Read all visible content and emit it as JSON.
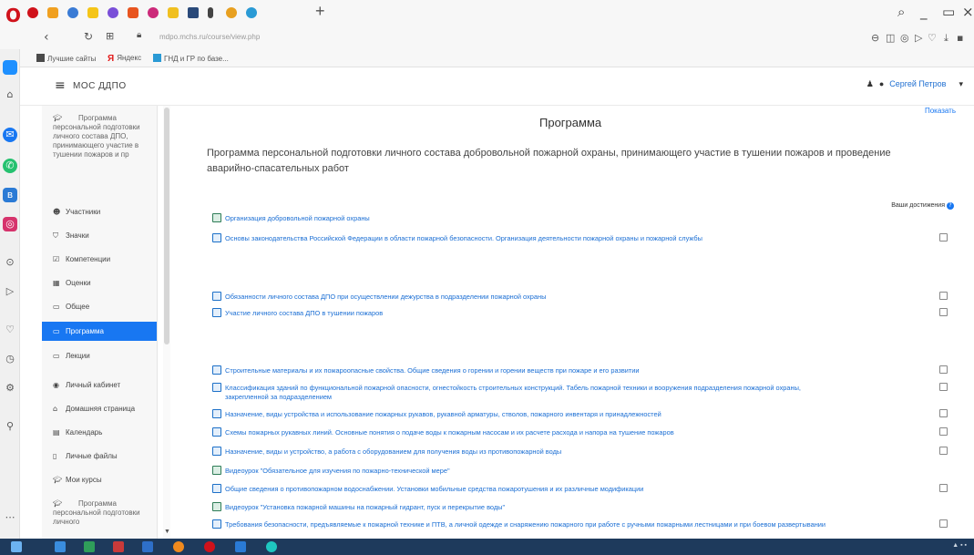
{
  "browser": {
    "url": "mdpo.mchs.ru/course/view.php",
    "bookmarks": [
      {
        "label": "Лучшие сайты",
        "icon": "bookmark-icon"
      },
      {
        "label": "Яндекс",
        "icon": "yandex-icon"
      },
      {
        "label": "ГНД и ГР по базе...",
        "icon": "folder-icon"
      }
    ],
    "colors": {
      "accent": "#1877f2",
      "taskbar": "#1e3a5c",
      "opera": "#d0121b"
    }
  },
  "header": {
    "brand": "МОС ДДПО",
    "user_name": "Сергей Петров"
  },
  "nav": {
    "items": [
      {
        "label": "Программа персональной подготовки личного состава ДПО, принимающего участие в тушении пожаров и пр",
        "icon": "graduation-cap-icon"
      },
      {
        "label": "Участники",
        "icon": "users-icon"
      },
      {
        "label": "Значки",
        "icon": "shield-icon"
      },
      {
        "label": "Компетенции",
        "icon": "check-circle-icon"
      },
      {
        "label": "Оценки",
        "icon": "table-icon"
      },
      {
        "label": "Общее",
        "icon": "folder-icon"
      },
      {
        "label": "Программа",
        "icon": "folder-icon"
      },
      {
        "label": "Лекции",
        "icon": "folder-icon"
      },
      {
        "label": "Личный кабинет",
        "icon": "dashboard-icon"
      },
      {
        "label": "Домашняя страница",
        "icon": "home-icon"
      },
      {
        "label": "Календарь",
        "icon": "calendar-icon"
      },
      {
        "label": "Личные файлы",
        "icon": "file-icon"
      },
      {
        "label": "Мои курсы",
        "icon": "graduation-cap-icon"
      },
      {
        "label": "Программа персональной подготовки личного",
        "icon": "graduation-cap-icon"
      }
    ]
  },
  "main": {
    "expand_link": "Показать",
    "title": "Программа",
    "description": "Программа персональной подготовки личного состава добровольной пожарной охраны, принимающего участие в тушении пожаров и проведение аварийно-спасательных работ",
    "progress_label": "Ваши достижения",
    "activities": [
      {
        "text": "Организация добровольной пожарной охраны",
        "icon": "file",
        "checkbox": false
      },
      {
        "text": "Основы законодательства Российской Федерации в области пожарной безопасности. Организация деятельности пожарной охраны и пожарной службы",
        "icon": "page",
        "checkbox": true
      },
      {
        "text": "Обязанности личного состава ДПО при осуществлении дежурства в подразделении пожарной охраны",
        "icon": "page",
        "checkbox": true
      },
      {
        "text": "Участие личного состава ДПО в тушении пожаров",
        "icon": "page",
        "checkbox": true
      },
      {
        "text": "Строительные материалы и их пожароопасные свойства. Общие сведения о горении и горении веществ при пожаре и его развитии",
        "icon": "page",
        "checkbox": true
      },
      {
        "text": "Классификация зданий по функциональной пожарной опасности, огнестойкость строительных конструкций. Табель пожарной техники и вооружения подразделения пожарной охраны,",
        "text2": "закрепленной за подразделением",
        "icon": "page",
        "checkbox": true
      },
      {
        "text": "Назначение, виды устройства и использование пожарных рукавов, рукавной арматуры, стволов, пожарного инвентаря и принадлежностей",
        "icon": "page",
        "checkbox": true
      },
      {
        "text": "Схемы пожарных рукавных линий. Основные понятия о подаче воды к пожарным насосам и их расчете расхода и напора на тушение пожаров",
        "icon": "page",
        "checkbox": true
      },
      {
        "text": "Назначение, виды и устройство, а работа с оборудованием для получения воды из противопожарной воды",
        "icon": "page",
        "checkbox": true
      },
      {
        "text": "Видеоурок \"Обязательное для изучения по пожарно-технической мере\"",
        "icon": "file",
        "checkbox": false
      },
      {
        "text": "Общие сведения о противопожарном водоснабжении. Установки мобильные средства пожаротушения и их различные модификации",
        "icon": "page",
        "checkbox": true
      },
      {
        "text": "Видеоурок \"Установка пожарной машины на пожарный гидрант, пуск и перекрытие воды\"",
        "icon": "file",
        "checkbox": false
      },
      {
        "text": "Требования безопасности, предъявляемые к пожарной технике и ПТВ, а личной одежде и снаряжению пожарного при работе с ручными пожарными лестницами и при боевом развертывании",
        "icon": "page",
        "checkbox": true
      }
    ]
  }
}
